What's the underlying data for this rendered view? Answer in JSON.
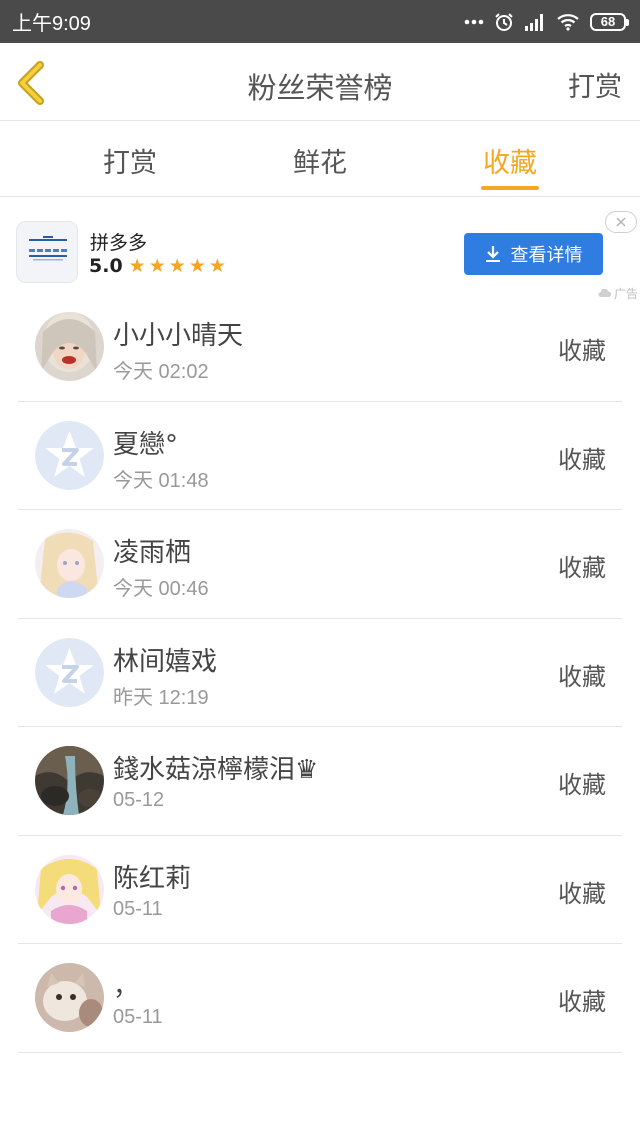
{
  "status_bar": {
    "time": "上午9:09",
    "battery": "68",
    "icons": [
      "more-icon",
      "alarm-icon",
      "signal-icon",
      "wifi-icon",
      "battery-icon"
    ]
  },
  "header": {
    "title": "粉丝荣誉榜",
    "action": "打赏"
  },
  "tabs": [
    {
      "label": "打赏",
      "active": false
    },
    {
      "label": "鲜花",
      "active": false
    },
    {
      "label": "收藏",
      "active": true
    }
  ],
  "ad": {
    "app_name": "拼多多",
    "rating": "5.0",
    "cta": "查看详情",
    "label": "广告"
  },
  "fans": [
    {
      "name": "小小小晴天",
      "time": "今天 02:02",
      "action": "收藏",
      "avatar": "photo-girl"
    },
    {
      "name": "夏戀°",
      "time": "今天 01:48",
      "action": "收藏",
      "avatar": "qq-default"
    },
    {
      "name": "凌雨栖",
      "time": "今天 00:46",
      "action": "收藏",
      "avatar": "anime-girl"
    },
    {
      "name": "林间嬉戏",
      "time": "昨天 12:19",
      "action": "收藏",
      "avatar": "qq-default"
    },
    {
      "name": "錢水菇涼檸檬泪♛",
      "time": "05-12",
      "action": "收藏",
      "avatar": "waterfall-photo"
    },
    {
      "name": "陈红莉",
      "time": "05-11",
      "action": "收藏",
      "avatar": "anime-blonde"
    },
    {
      "name": "，",
      "time": "05-11",
      "action": "收藏",
      "avatar": "cat-photo"
    }
  ],
  "colors": {
    "accent": "#f5a623",
    "status_bar": "#4a4a4a",
    "cta": "#2f7de1"
  }
}
